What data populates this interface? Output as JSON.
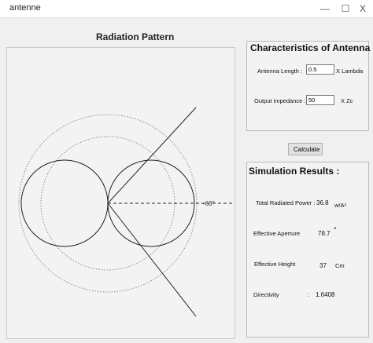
{
  "window": {
    "title": "antenne",
    "min_label": "—",
    "max_label": "☐",
    "close_label": "X"
  },
  "plot": {
    "title": "Radiation Pattern",
    "angle_label": "-63°"
  },
  "characteristics": {
    "title": "Characteristics of Antenna :",
    "antenna_length": {
      "label": "Antenna Length :",
      "value": "0.5",
      "unit": "X Lambda"
    },
    "output_impedance": {
      "label": "Output impedance :",
      "value": "50",
      "unit": "X Zc"
    }
  },
  "calculate_label": "Calculate",
  "results": {
    "title": "Simulation Results :",
    "rows": [
      {
        "label": "Total Radiated Power :",
        "value": "36.8",
        "unit": "w/A²"
      },
      {
        "label": "Effective Aperture",
        "value": "78.7",
        "unit": "°"
      },
      {
        "label": "Effective Height",
        "value": "37",
        "unit": "Cm"
      },
      {
        "label": "Directivity",
        "value": "1.6408",
        "unit": ""
      }
    ],
    "colon": ":"
  }
}
